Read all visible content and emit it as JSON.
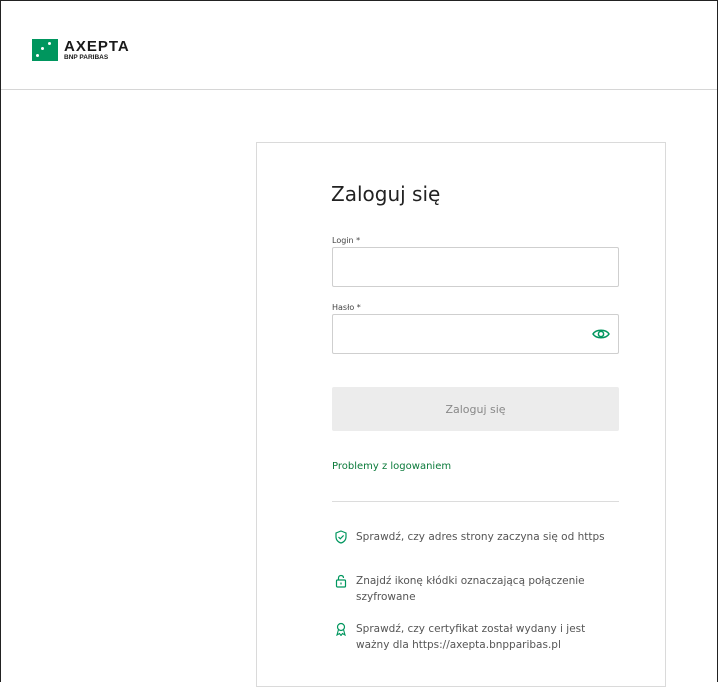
{
  "header": {
    "logo_name": "AXEPTA",
    "logo_sub": "BNP PARIBAS"
  },
  "login": {
    "title": "Zaloguj się",
    "login_label": "Login *",
    "login_value": "",
    "password_label": "Hasło *",
    "password_value": "",
    "submit_label": "Zaloguj się",
    "problems_link": "Problemy z logowaniem"
  },
  "tips": [
    {
      "icon": "shield-check-icon",
      "text": "Sprawdź, czy adres strony zaczyna się od https"
    },
    {
      "icon": "padlock-icon",
      "text": "Znajdź ikonę kłódki oznaczającą połączenie szyfrowane"
    },
    {
      "icon": "certificate-award-icon",
      "text": "Sprawdź, czy certyfikat został wydany i jest ważny dla https://axepta.bnpparibas.pl"
    }
  ],
  "colors": {
    "brand_green": "#00965e",
    "link_green": "#0a7a3a",
    "button_bg": "#ececec"
  }
}
